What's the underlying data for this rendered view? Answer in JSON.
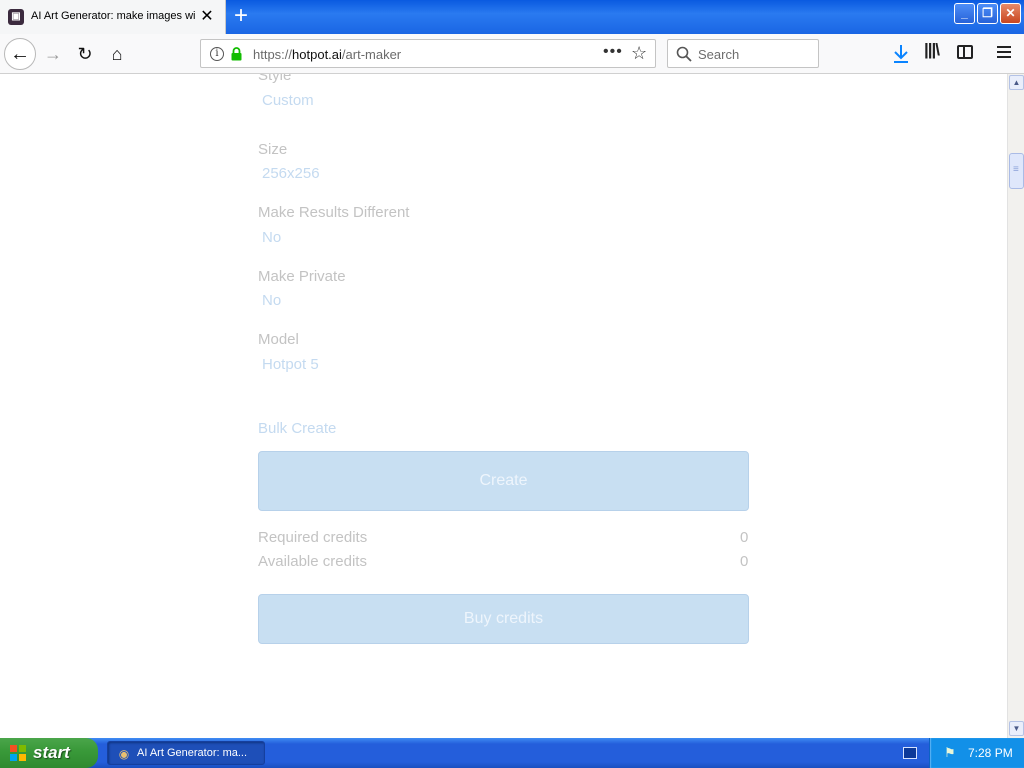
{
  "browser": {
    "tab_title": "AI Art Generator: make images wi",
    "tab_favicon": "hotpot-favicon",
    "url_prefix": "https://",
    "url_domain": "hotpot.ai",
    "url_path": "/art-maker",
    "search_placeholder": "Search",
    "close_glyph": "✕",
    "new_tab_glyph": "+",
    "icons": {
      "back": "back-arrow-icon",
      "forward": "forward-arrow-icon",
      "reload": "reload-icon",
      "home": "home-icon",
      "info": "info-icon",
      "lock": "lock-icon",
      "page_actions": "more-dots-icon",
      "bookmark": "star-icon",
      "search": "search-icon",
      "download": "download-icon",
      "library": "library-icon",
      "sidebar": "sidebar-icon",
      "menu": "hamburger-menu-icon"
    },
    "accent_color": "#2a7af0"
  },
  "form": {
    "fields": [
      {
        "label": "Style",
        "value": "Custom"
      },
      {
        "label": "Size",
        "value": "256x256"
      },
      {
        "label": "Make Results Different",
        "value": "No"
      },
      {
        "label": "Make Private",
        "value": "No"
      },
      {
        "label": "Model",
        "value": "Hotpot 5"
      }
    ],
    "bulk_create_label": "Bulk Create",
    "create_button_label": "Create",
    "credits": [
      {
        "label": "Required credits",
        "value": "0"
      },
      {
        "label": "Available credits",
        "value": "0"
      }
    ],
    "buy_button_label": "Buy credits",
    "button_color": "#c8dff2",
    "label_color": "#c3c3c3",
    "value_color": "#c4daf0"
  },
  "taskbar": {
    "start_label": "start",
    "task_label": "AI Art Generator: ma...",
    "clock": "7:28 PM"
  }
}
